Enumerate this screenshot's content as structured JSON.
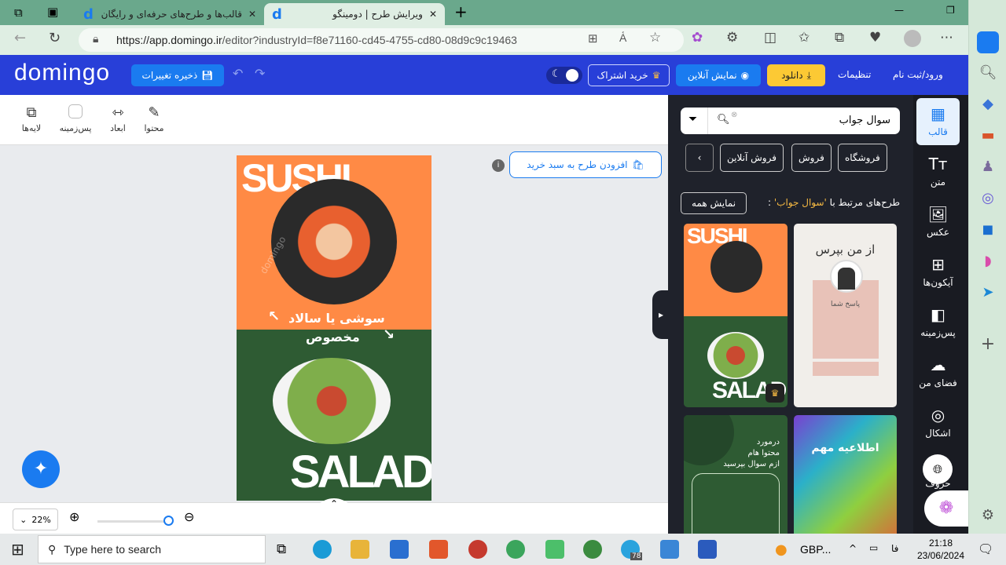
{
  "browser": {
    "tabs": [
      {
        "title": "قالب‌ها و طرح‌های حرفه‌ای و رایگان"
      },
      {
        "title": "ویرایش طرح | دومینگو"
      }
    ],
    "url_host": "https://app.domingo.ir",
    "url_path": "/editor?industryId=f8e71160-cd45-4755-cd80-08d9c9c19463"
  },
  "header": {
    "logo": "domingo",
    "save": "ذخیره تغییرات",
    "subscribe": "خرید اشتراک",
    "preview": "نمایش آنلاین",
    "download": "دانلود",
    "settings": "تنظیمات",
    "login": "ورود/ثبت نام"
  },
  "toolbar": {
    "items": [
      "محتوا",
      "ابعاد",
      "پس‌زمینه",
      "لایه‌ها"
    ]
  },
  "canvas": {
    "add_to_cart": "افزودن طرح به سبد خرید",
    "zoom": "22%",
    "design": {
      "title_top": "SUSHI",
      "caption1": "سوشی یا سالاد",
      "caption2": "مخصوص",
      "title_bottom": "SALAD",
      "watermark": "domingo"
    }
  },
  "panel": {
    "search_value": "سوال جواب",
    "chips": [
      "فروشگاه",
      "فروش",
      "فروش آنلاین"
    ],
    "related_prefix": "طرح‌های مرتبط با",
    "related_term": "'سوال جواب'",
    "show_all": "نمایش همه",
    "thumbs": {
      "t1_title": "از من بپرس",
      "t1_body": "پاسخ شما",
      "t2_title": "SUSHI",
      "t2_bottom": "SALAD",
      "t3_text": [
        "درمورد",
        "محتوا هام",
        "ازم سوال بپرسید"
      ],
      "t4_title": "اطلاعیه مهم"
    }
  },
  "rail": {
    "items": [
      "قالب",
      "متن",
      "عکس",
      "آیکون‌ها",
      "پس‌زمینه",
      "فضای من",
      "اشکال",
      "حروف"
    ]
  },
  "taskbar": {
    "search": "Type here to search",
    "ticker": "GBP...",
    "lang": "فا",
    "time": "21:18",
    "date": "23/06/2024",
    "badge": "78"
  },
  "colors": {
    "header": "#283fd8",
    "accent": "#1a7bf0",
    "download": "#fcc934",
    "panel": "#1f222b",
    "orange": "#ff8a45",
    "green": "#2e5b33"
  }
}
